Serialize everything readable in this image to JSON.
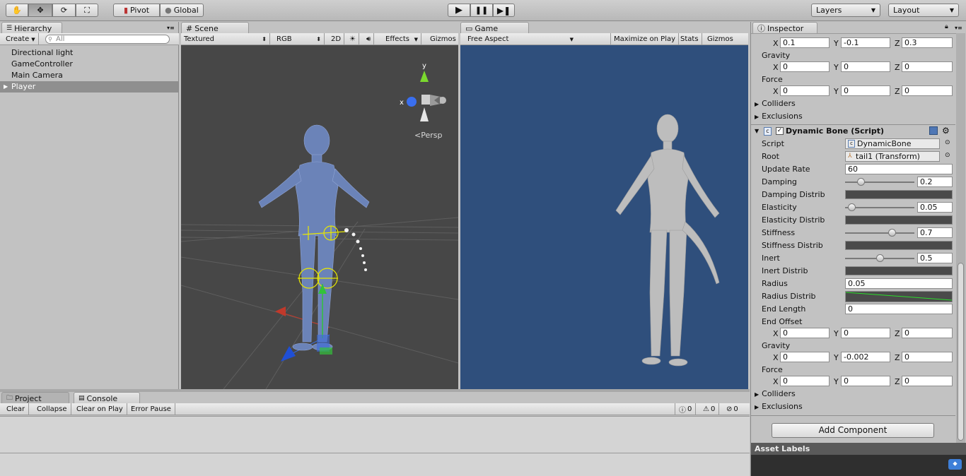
{
  "toolbar": {
    "pivot": "Pivot",
    "global": "Global",
    "layers": "Layers",
    "layout": "Layout"
  },
  "hierarchy": {
    "tab": "Hierarchy",
    "create": "Create",
    "search_placeholder": "All",
    "items": [
      "Directional light",
      "GameController",
      "Main Camera",
      "Player"
    ]
  },
  "scene": {
    "tab": "Scene",
    "shading": "Textured",
    "render": "RGB",
    "mode2d": "2D",
    "effects": "Effects",
    "gizmos": "Gizmos",
    "persp": "Persp",
    "axis_x": "x",
    "axis_y": "y"
  },
  "game": {
    "tab": "Game",
    "aspect": "Free Aspect",
    "maximize": "Maximize on Play",
    "stats": "Stats",
    "gizmos": "Gizmos"
  },
  "inspector": {
    "tab": "Inspector",
    "top": {
      "end_offset": {
        "x": "0.1",
        "y": "-0.1",
        "z": "0.3"
      },
      "gravity_label": "Gravity",
      "gravity": {
        "x": "0",
        "y": "0",
        "z": "0"
      },
      "force_label": "Force",
      "force": {
        "x": "0",
        "y": "0",
        "z": "0"
      },
      "colliders": "Colliders",
      "exclusions": "Exclusions"
    },
    "component": {
      "title": "Dynamic Bone (Script)",
      "script_label": "Script",
      "script": "DynamicBone",
      "root_label": "Root",
      "root": "tail1 (Transform)",
      "update_rate_label": "Update Rate",
      "update_rate": "60",
      "damping_label": "Damping",
      "damping": "0.2",
      "damping_level": 0.2,
      "damping_distrib": "Damping Distrib",
      "elasticity_label": "Elasticity",
      "elasticity": "0.05",
      "elasticity_level": 0.05,
      "elasticity_distrib": "Elasticity Distrib",
      "stiffness_label": "Stiffness",
      "stiffness": "0.7",
      "stiffness_level": 0.7,
      "stiffness_distrib": "Stiffness Distrib",
      "inert_label": "Inert",
      "inert": "0.5",
      "inert_level": 0.5,
      "inert_distrib": "Inert Distrib",
      "radius_label": "Radius",
      "radius": "0.05",
      "radius_distrib": "Radius Distrib",
      "end_length_label": "End Length",
      "end_length": "0",
      "end_offset_label": "End Offset",
      "end_offset": {
        "x": "0",
        "y": "0",
        "z": "0"
      },
      "gravity_label": "Gravity",
      "gravity": {
        "x": "0",
        "y": "-0.002",
        "z": "0"
      },
      "force_label": "Force",
      "force": {
        "x": "0",
        "y": "0",
        "z": "0"
      },
      "colliders": "Colliders",
      "exclusions": "Exclusions"
    },
    "add_component": "Add Component",
    "asset_labels": "Asset Labels",
    "axis": {
      "x": "X",
      "y": "Y",
      "z": "Z"
    }
  },
  "console": {
    "project_tab": "Project",
    "console_tab": "Console",
    "clear": "Clear",
    "collapse": "Collapse",
    "clear_on_play": "Clear on Play",
    "error_pause": "Error Pause",
    "info_count": "0",
    "warn_count": "0",
    "error_count": "0"
  },
  "colors": {
    "scene_bg": "#474747",
    "game_bg": "#2f4f7c",
    "selection": "#8f8f8f"
  }
}
